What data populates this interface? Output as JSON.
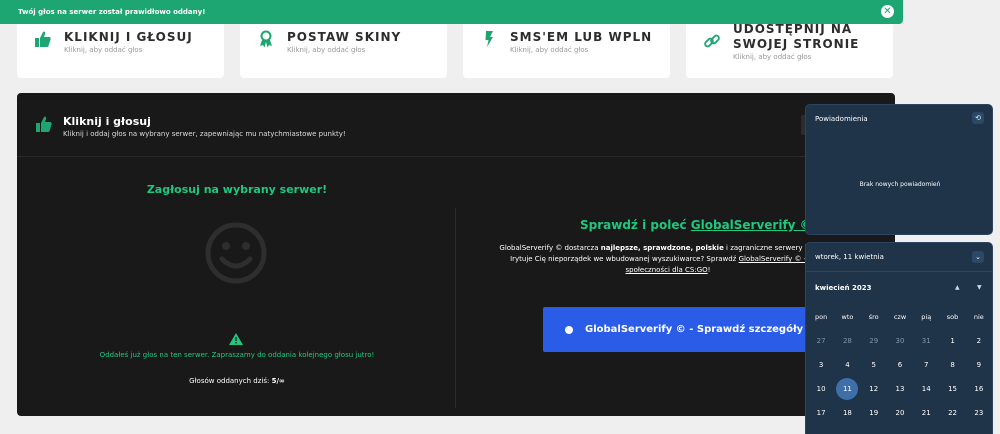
{
  "toast": {
    "message": "Twój głos na serwer został prawidłowo oddany!",
    "close_icon": "close-icon"
  },
  "cards": [
    {
      "title": "KLIKNIJ I GŁOSUJ",
      "sub": "Kliknij, aby oddać głos",
      "icon": "thumbs-up-icon"
    },
    {
      "title": "POSTAW SKINY",
      "sub": "Kliknij, aby oddać głos",
      "icon": "award-icon"
    },
    {
      "title": "SMS'EM LUB WPLN",
      "sub": "Kliknij, aby oddać głos",
      "icon": "lightning-icon"
    },
    {
      "title_line1": "UDOSTĘPNIJ NA",
      "title_line2": "SWOJEJ STRONIE",
      "sub": "Kliknij, aby oddać głos",
      "icon": "link-icon"
    }
  ],
  "panel": {
    "title": "Kliknij i głosuj",
    "subtitle": "Kliknij i oddaj głos na wybrany serwer, zapewniając mu natychmiastowe punkty!",
    "button_label": "Z",
    "left": {
      "title": "Zagłosuj na wybrany serwer!",
      "note": "Oddałeś już głos na ten serwer. Zapraszamy do oddania kolejnego głosu jutro!",
      "count_label": "Głosów oddanych dziś:",
      "count_value": "5/∞"
    },
    "right": {
      "title_prefix": "Sprawdź i poleć",
      "title_link": "GlobalServerify ©",
      "desc_1": "GlobalServerify © dostarcza",
      "desc_bold": "najlepsze, sprawdzone, polskie",
      "desc_2": "i zagraniczne serwery bezpośre",
      "desc_line2": "Irytuje Cię nieporządek we wbudowanej wyszukiwarce? Sprawdź",
      "desc_link1": "GlobalServerify © - doda",
      "desc_link2": "społeczności dla CS:GO",
      "desc_end": "!",
      "cta_label": "GlobalServerify © - Sprawdź szczegóły"
    }
  },
  "notifications": {
    "title": "Powiadomienia",
    "empty": "Brak nowych powiadomień"
  },
  "calendar": {
    "date_label": "wtorek, 11 kwietnia",
    "month_label": "kwiecień 2023",
    "weekdays": [
      "pon",
      "wto",
      "śro",
      "czw",
      "pią",
      "sob",
      "nie"
    ],
    "weeks": [
      [
        "27",
        "28",
        "29",
        "30",
        "31",
        "1",
        "2"
      ],
      [
        "3",
        "4",
        "5",
        "6",
        "7",
        "8",
        "9"
      ],
      [
        "10",
        "11",
        "12",
        "13",
        "14",
        "15",
        "16"
      ],
      [
        "17",
        "18",
        "19",
        "20",
        "21",
        "22",
        "23"
      ],
      [
        "24",
        "25",
        "26",
        "27",
        "28",
        "29",
        "30"
      ]
    ],
    "today": "11"
  }
}
